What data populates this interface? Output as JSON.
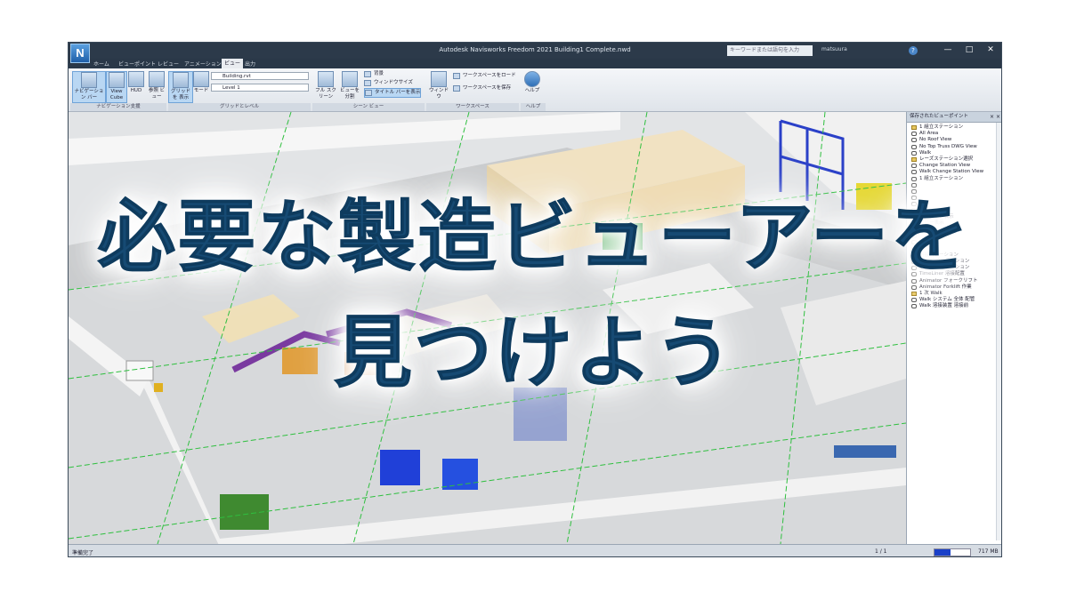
{
  "window": {
    "title": "Autodesk Navisworks Freedom 2021  Building1 Complete.nwd",
    "logo_letter": "N",
    "search_placeholder": "キーワードまたは語句を入力",
    "user": "matsuura",
    "help_glyph": "?",
    "minimize_glyph": "—",
    "maximize_glyph": "□",
    "close_glyph": "✕"
  },
  "tabs": [
    {
      "label": "ホーム"
    },
    {
      "label": "ビューポイント"
    },
    {
      "label": "レビュー"
    },
    {
      "label": "アニメーション"
    },
    {
      "label": "ビュー",
      "active": true
    },
    {
      "label": "出力"
    }
  ],
  "ribbon": {
    "groups": [
      {
        "label": "ナビゲーション支援"
      },
      {
        "label": "グリッドとレベル"
      },
      {
        "label": "シーン ビュー"
      },
      {
        "label": "ワークスペース"
      },
      {
        "label": "ヘルプ"
      }
    ],
    "buttons": {
      "nav_bar": "ナビゲーション バー",
      "view_cube": "View Cube",
      "hud": "HUD",
      "ref_view": "参照 ビュー",
      "show_grid": "グリッドを 表示",
      "mode": "モード",
      "building_combo": "Building.rvt",
      "level_combo": "Level 1",
      "fullscreen": "フル スクリーン",
      "split_view": "ビューを 分割",
      "background": "背景",
      "window_size": "ウィンドウサイズ",
      "title_bar": "タイトル バーを表示",
      "windows": "ウィンドウ",
      "load_workspace": "ワークスペースをロード",
      "save_workspace": "ワークスペースを保存",
      "help": "ヘルプ"
    }
  },
  "side_panel": {
    "title": "保存されたビューポイント",
    "controls": "× ×",
    "items": [
      {
        "label": "1 組立ステーション",
        "kind": "folder"
      },
      {
        "label": "All Area",
        "kind": "view"
      },
      {
        "label": "No Roof View",
        "kind": "view"
      },
      {
        "label": "No Top Truss DWG View",
        "kind": "view"
      },
      {
        "label": "Walk",
        "kind": "view"
      },
      {
        "label": "レーズステーション選択",
        "kind": "folder"
      },
      {
        "label": "Change Station View",
        "kind": "view"
      },
      {
        "label": "Walk Change Station View",
        "kind": "view"
      },
      {
        "label": "1 組立ステーション",
        "kind": "view"
      },
      {
        "label": "",
        "kind": "view"
      },
      {
        "label": "",
        "kind": "view"
      },
      {
        "label": "",
        "kind": "view"
      },
      {
        "label": "",
        "kind": "view"
      },
      {
        "label": "",
        "kind": "view"
      },
      {
        "label": "インテリア表示",
        "kind": "view"
      },
      {
        "label": "ロビー表示",
        "kind": "view"
      },
      {
        "label": "",
        "kind": "view"
      },
      {
        "label": "",
        "kind": "view"
      },
      {
        "label": "",
        "kind": "view"
      },
      {
        "label": "",
        "kind": "view"
      },
      {
        "label": "溶接ステーション",
        "kind": "folder"
      },
      {
        "label": "1 次 溶接ステーション",
        "kind": "view"
      },
      {
        "label": "1 次 溶接ステーション",
        "kind": "view"
      },
      {
        "label": "TimeLiner 溶接配置",
        "kind": "view"
      },
      {
        "label": "Animator フォークリフト",
        "kind": "view"
      },
      {
        "label": "Animator Forklift 作業",
        "kind": "view"
      },
      {
        "label": "1 次 Walk",
        "kind": "folder"
      },
      {
        "label": "Walk システム 全体 配管",
        "kind": "view"
      },
      {
        "label": "Walk 溶接装置 溶接前",
        "kind": "view"
      }
    ]
  },
  "status": {
    "text": "準備完了",
    "page": "1 / 1",
    "memory_fraction": 0.45,
    "memory_value": "717 MB"
  },
  "headline": {
    "line1": "必要な製造ビューアーを",
    "line2": "見つけよう"
  },
  "colors": {
    "headline": "#164a73",
    "grid_line": "#2fbf3f",
    "title_bar": "#2c3a4a"
  }
}
